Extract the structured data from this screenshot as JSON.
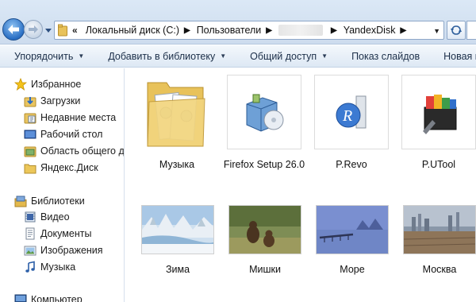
{
  "address": {
    "crumbs": [
      "Локальный диск (C:)",
      "Пользователи",
      "YandexDisk"
    ]
  },
  "toolbar": {
    "organize": "Упорядочить",
    "add_to_library": "Добавить в библиотеку",
    "share": "Общий доступ",
    "slideshow": "Показ слайдов",
    "new_folder": "Новая папк"
  },
  "nav": {
    "favorites": "Избранное",
    "downloads": "Загрузки",
    "recent": "Недавние места",
    "desktop": "Рабочий стол",
    "shared": "Область общего дс",
    "yandex": "Яндекс.Диск",
    "libraries": "Библиотеки",
    "video": "Видео",
    "documents": "Документы",
    "images": "Изображения",
    "music": "Музыка",
    "computer": "Компьютер"
  },
  "files": [
    {
      "name": "Музыка"
    },
    {
      "name": "Firefox Setup 26.0"
    },
    {
      "name": "P.Revo"
    },
    {
      "name": "P.UTool"
    }
  ],
  "photos": [
    {
      "name": "Зима"
    },
    {
      "name": "Мишки"
    },
    {
      "name": "Море"
    },
    {
      "name": "Москва"
    }
  ]
}
